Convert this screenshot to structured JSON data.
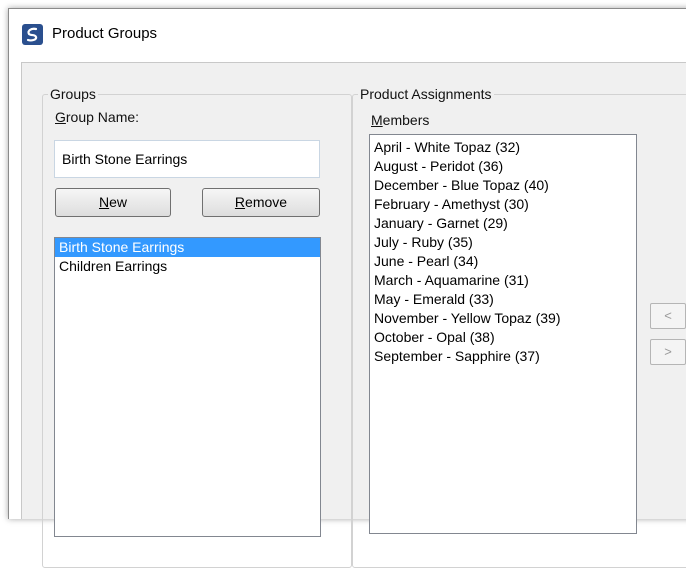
{
  "window": {
    "title": "Product Groups"
  },
  "groups": {
    "legend": "Groups",
    "name_label_prefix": "G",
    "name_label_rest": "roup Name:",
    "name_value": "Birth Stone Earrings",
    "new_button_underlined": "N",
    "new_button_rest": "ew",
    "remove_button_underlined": "R",
    "remove_button_rest": "emove",
    "list": [
      {
        "label": "Birth Stone Earrings",
        "selected": true
      },
      {
        "label": "Children Earrings",
        "selected": false
      }
    ]
  },
  "assignments": {
    "legend": "Product Assignments",
    "members_label_underlined": "M",
    "members_label_rest": "embers",
    "members": [
      "April - White Topaz (32)",
      "August - Peridot (36)",
      "December - Blue Topaz (40)",
      "February - Amethyst (30)",
      "January - Garnet (29)",
      "July - Ruby (35)",
      "June - Pearl (34)",
      "March - Aquamarine (31)",
      "May - Emerald (33)",
      "November - Yellow Topaz (39)",
      "October - Opal (38)",
      "September - Sapphire (37)"
    ],
    "move_left_label": "<",
    "move_right_label": ">"
  },
  "colors": {
    "selection": "#3399ff",
    "app_icon": "#2a4f8e"
  },
  "icons": {
    "app": "app-logo-icon"
  }
}
